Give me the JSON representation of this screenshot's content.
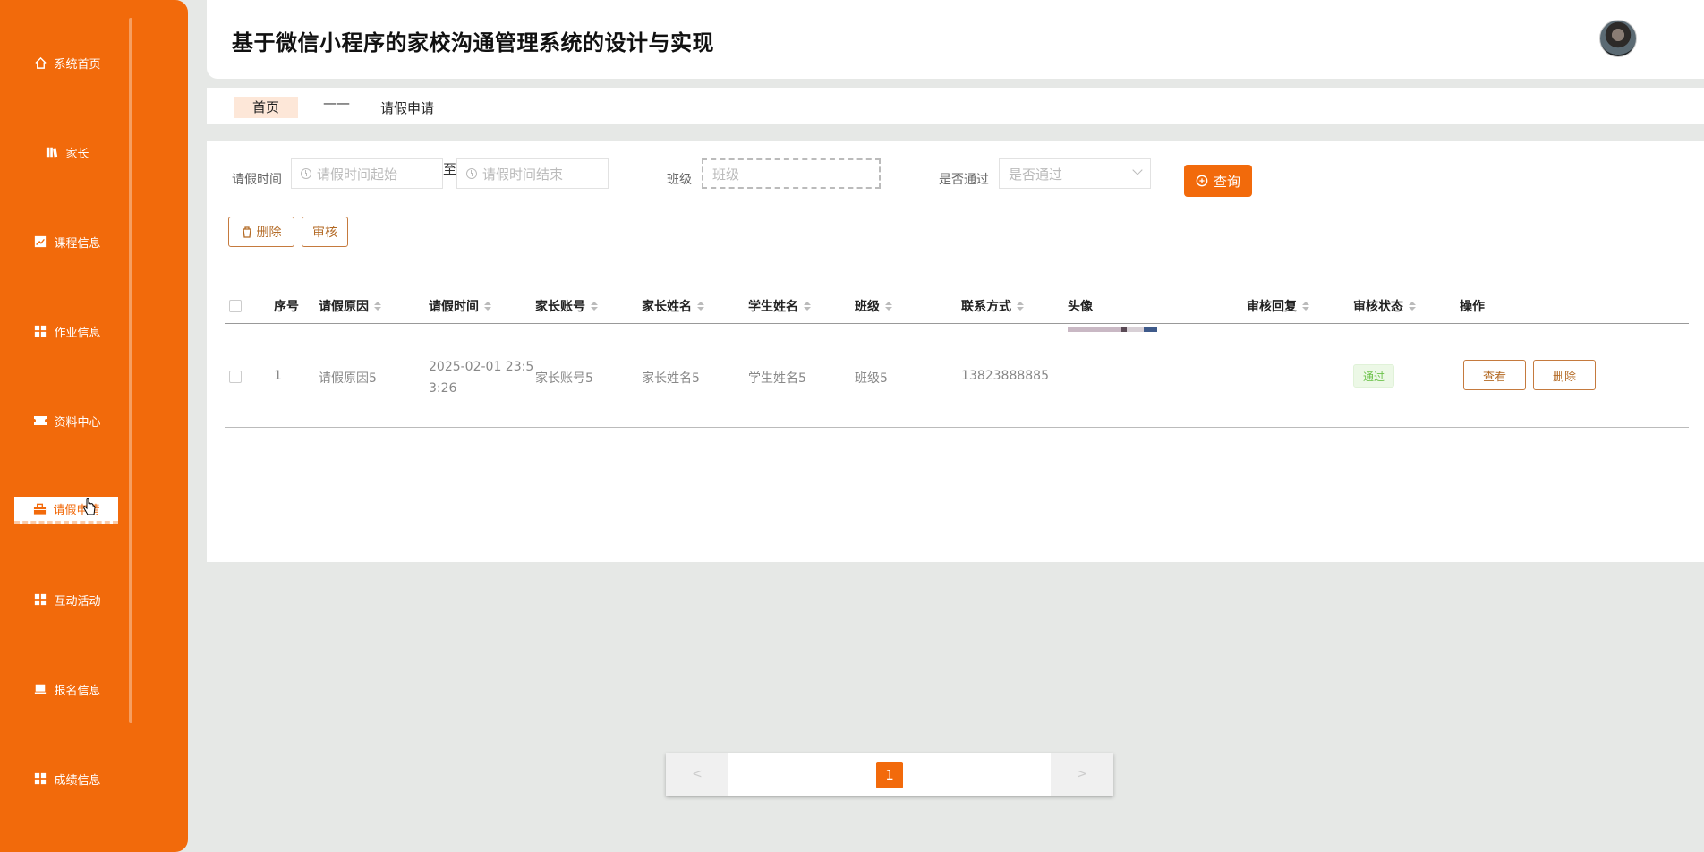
{
  "header": {
    "title": "基于微信小程序的家校沟通管理系统的设计与实现"
  },
  "sidebar": {
    "items": [
      {
        "label": "系统首页",
        "icon": "home-icon"
      },
      {
        "label": "家长",
        "icon": "book-icon"
      },
      {
        "label": "课程信息",
        "icon": "chart-icon"
      },
      {
        "label": "作业信息",
        "icon": "grid-icon"
      },
      {
        "label": "资料中心",
        "icon": "ticket-icon"
      },
      {
        "label": "请假申请",
        "icon": "briefcase-icon",
        "active": true
      },
      {
        "label": "互动活动",
        "icon": "grid-icon"
      },
      {
        "label": "报名信息",
        "icon": "monitor-icon"
      },
      {
        "label": "成绩信息",
        "icon": "grid-icon"
      }
    ]
  },
  "breadcrumb": {
    "home": "首页",
    "separator": "——",
    "current": "请假申请"
  },
  "search": {
    "time_label": "请假时间",
    "time_start_placeholder": "请假时间起始",
    "to_label": "至",
    "time_end_placeholder": "请假时间结束",
    "class_label": "班级",
    "class_placeholder": "班级",
    "approved_label": "是否通过",
    "approved_placeholder": "是否通过",
    "query_label": "查询"
  },
  "actions": {
    "delete_label": "删除",
    "review_label": "审核"
  },
  "table": {
    "columns": [
      "序号",
      "请假原因",
      "请假时间",
      "家长账号",
      "家长姓名",
      "学生姓名",
      "班级",
      "联系方式",
      "头像",
      "审核回复",
      "审核状态",
      "操作"
    ],
    "rows": [
      {
        "index": "1",
        "reason": "请假原因5",
        "time_line1": "2025-02-01 23:5",
        "time_line2": "3:26",
        "parent_account": "家长账号5",
        "parent_name": "家长姓名5",
        "student_name": "学生姓名5",
        "class": "班级5",
        "phone": "13823888885",
        "reply": "",
        "status": "通过",
        "view_label": "查看",
        "delete_label": "删除"
      }
    ]
  },
  "pagination": {
    "prev": "<",
    "page": "1",
    "next": ">"
  },
  "colors": {
    "accent": "#f26a0b",
    "success": "#6cc24a"
  }
}
